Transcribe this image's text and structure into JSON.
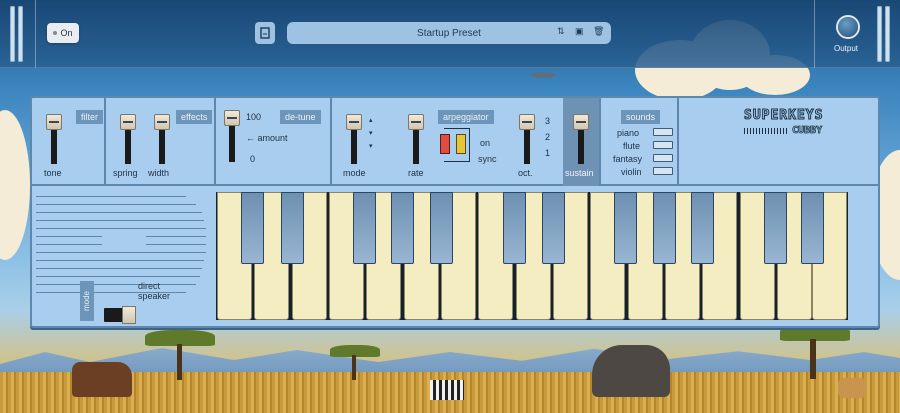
{
  "host": {
    "power_label": "On",
    "preset_name": "Startup Preset",
    "output_label": "Output"
  },
  "synth": {
    "logo_line1": "SUPERKEYS",
    "logo_line2": "CUBBY",
    "filter": {
      "tag": "filter",
      "tone_label": "tone"
    },
    "effects": {
      "tag": "effects",
      "spring_label": "spring",
      "width_label": "width"
    },
    "detune": {
      "tag": "de-tune",
      "amount_label": "amount",
      "max_label": "100",
      "min_label": "0"
    },
    "arp": {
      "tag": "arpeggiator",
      "mode_label": "mode",
      "rate_label": "rate",
      "on_label": "on",
      "sync_label": "sync",
      "oct_label": "oct.",
      "oct_values": [
        "3",
        "2",
        "1"
      ]
    },
    "sustain_label": "sustain",
    "sounds": {
      "tag": "sounds",
      "items": [
        "piano",
        "flute",
        "fantasy",
        "violin"
      ]
    },
    "mode_tag": "mode",
    "direct_speaker_label": "direct\nspeaker"
  }
}
